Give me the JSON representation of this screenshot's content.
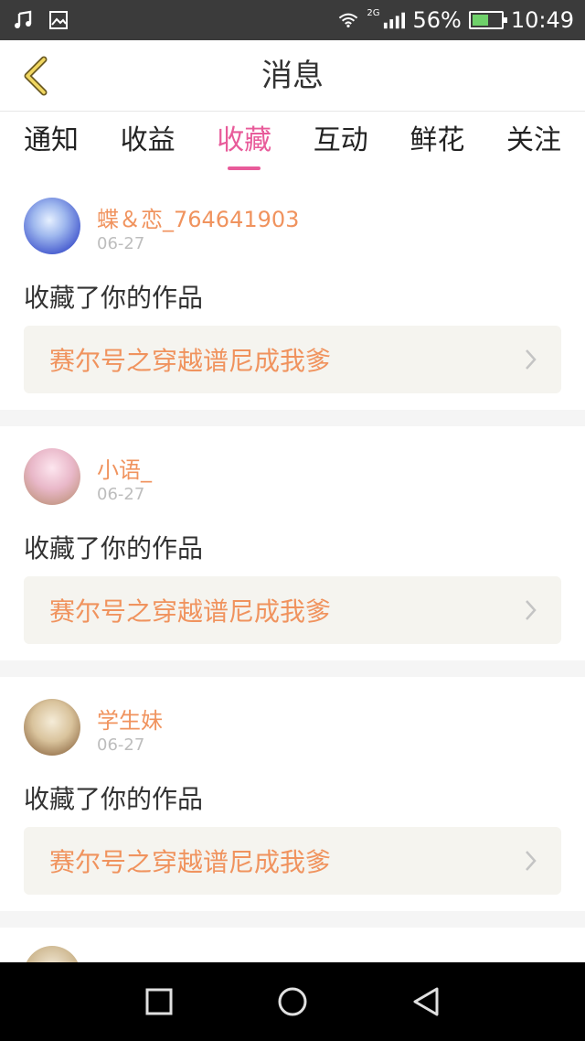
{
  "status": {
    "wifi_icon": "wifi-icon",
    "network": "2G",
    "battery": "56%",
    "battery_level": 0.56,
    "time": "10:49"
  },
  "header": {
    "title": "消息",
    "back_icon": "back-chevron-icon"
  },
  "tabs": [
    {
      "label": "通知"
    },
    {
      "label": "收益"
    },
    {
      "label": "收藏",
      "active": true
    },
    {
      "label": "互动"
    },
    {
      "label": "鲜花"
    },
    {
      "label": "关注"
    }
  ],
  "items": [
    {
      "username": "蝶＆恋_764641903",
      "date": "06-27",
      "action": "收藏了你的作品",
      "work_title": "赛尔号之穿越谱尼成我爹"
    },
    {
      "username": "小语_",
      "date": "06-27",
      "action": "收藏了你的作品",
      "work_title": "赛尔号之穿越谱尼成我爹"
    },
    {
      "username": "学生妹",
      "date": "06-27",
      "action": "收藏了你的作品",
      "work_title": "赛尔号之穿越谱尼成我爹"
    }
  ],
  "colors": {
    "accent": "#e85b9a",
    "name_orange": "#f0935e",
    "card_bg": "#f5f4ef"
  }
}
